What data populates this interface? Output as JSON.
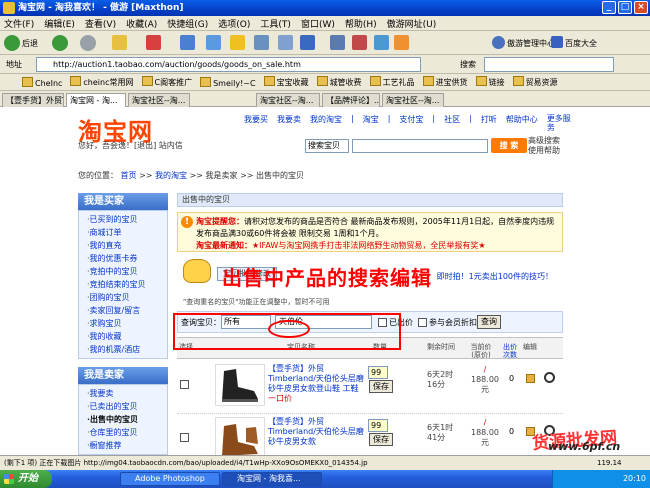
{
  "window": {
    "title": "淘宝网 - 淘我喜欢！ - 傲游 [Maxthon]"
  },
  "menu": [
    "文件(F)",
    "编辑(E)",
    "查看(V)",
    "收藏(A)",
    "快捷组(G)",
    "选项(O)",
    "工具(T)",
    "窗口(W)",
    "帮助(H)",
    "傲游网址(U)"
  ],
  "toolbar": {
    "back_label": "后退",
    "mgr_label": "傲游管理中心",
    "baidu_label": "百度大全"
  },
  "address": {
    "label": "地址",
    "url": "http://auction1.taobao.com/auction/goods/goods_on_sale.htm",
    "search_label": "搜索"
  },
  "links": [
    "CheInc",
    "cheinc常用网",
    "C阁客推广",
    "Smeily!~C",
    "宝宝收藏",
    "城管收费",
    "工艺礼品",
    "进宝供货",
    "链接",
    "贸易资源"
  ],
  "tabs": [
    "【壹手货】外贸T...",
    "淘宝网 - 淘...",
    "淘宝社区--淘...",
    "淘宝社区--淘...",
    "【品牌评论】...",
    "淘宝社区--淘..."
  ],
  "taobao": {
    "logo": "淘宝网",
    "welcome": "您好，吾会逸！[退出] 站内信",
    "nav": [
      "我要买",
      "我要卖",
      "我的淘宝",
      "|",
      "淘宝",
      "|",
      "支付宝",
      "|",
      "社区",
      "|",
      "打听",
      "帮助中心",
      "更多服务"
    ],
    "search_scope": "搜索宝贝",
    "search_btn": "搜 索",
    "adv_search": "高级搜索 使用帮助",
    "breadcrumb": {
      "prefix": "您的位置：",
      "home": "首页",
      "mine": "我的淘宝",
      "seller": "我是卖家",
      "current": "出售中的宝贝",
      "sep": ">>"
    }
  },
  "sidebar": {
    "buyer_title": "我是买家",
    "buyer_items": [
      "已买到的宝贝",
      "商城订单",
      "我的直充",
      "我的优惠卡券",
      "竞拍中的宝贝",
      "竞拍结束的宝贝",
      "团购的宝贝",
      "卖家回复/留言",
      "求购宝贝",
      "我的收藏",
      "我的机票/酒店"
    ],
    "seller_title": "我是卖家",
    "seller_items": [
      "我要卖",
      "已卖出的宝贝",
      "出售中的宝贝",
      "仓库里的宝贝",
      "橱窗推荐"
    ]
  },
  "main": {
    "header": "出售中的宝贝",
    "notice1_tag": "淘宝提醒您：",
    "notice1_text": "请积对您发布的商品是否符合 最新商品发布规则，2005年11月1日起，自然季度内违规发布商品满30或60件将会被 限制交易 1周和1个月。",
    "notice2_tag": "淘宝最新通知：",
    "notice2_text": "★IFAW与淘宝网携手打击非法网络野生动物贸易，全民举报有奖★",
    "batch_btn": "宝贝批量修改",
    "right_links": "即时拍！1元卖出100件的技巧！",
    "tip": "\"查询重名的宝贝\"功能正在调整中，暂时不可用",
    "overlay": "出售中产品的搜索编辑",
    "filter": {
      "label": "查询宝贝：",
      "select": "所有",
      "value": "天伯伦",
      "opt1": "已出价",
      "opt2": "参与会员折扣",
      "query_btn": "查询"
    },
    "columns": [
      "选择",
      "宝贝名称",
      "数量",
      "剩余时间",
      "当前价(原价)",
      "出价次数",
      "编辑"
    ],
    "rows": [
      {
        "title": "【壹手货】外贸Timberland/天伯伦头层磨砂牛皮男女款登山鞋 工鞋",
        "tag": "一口价",
        "qty": "99",
        "save": "保存",
        "remain": "6天2时16分",
        "price": "188.00元",
        "bids": "0"
      },
      {
        "title": "【壹手货】外贸Timberland/天伯伦头层磨砂牛皮男女款",
        "tag": "",
        "qty": "99",
        "save": "保存",
        "remain": "6天1时41分",
        "price": "188.00元",
        "bids": "0"
      }
    ]
  },
  "watermark": {
    "cn": "货源批发网",
    "en": "www.6pf.cn"
  },
  "status": {
    "text": "(剩下1 项) 正在下载图片 http://img04.taobaocdn.com/bao/uploaded/i4/T1wHp-XXo9OsOMEKX0_014354.jp",
    "zoom": "119.14"
  },
  "taskbar": {
    "start": "开始",
    "tasks": [
      "Adobe Photoshop",
      "淘宝网 - 淘我喜..."
    ],
    "clock": "20:10"
  }
}
